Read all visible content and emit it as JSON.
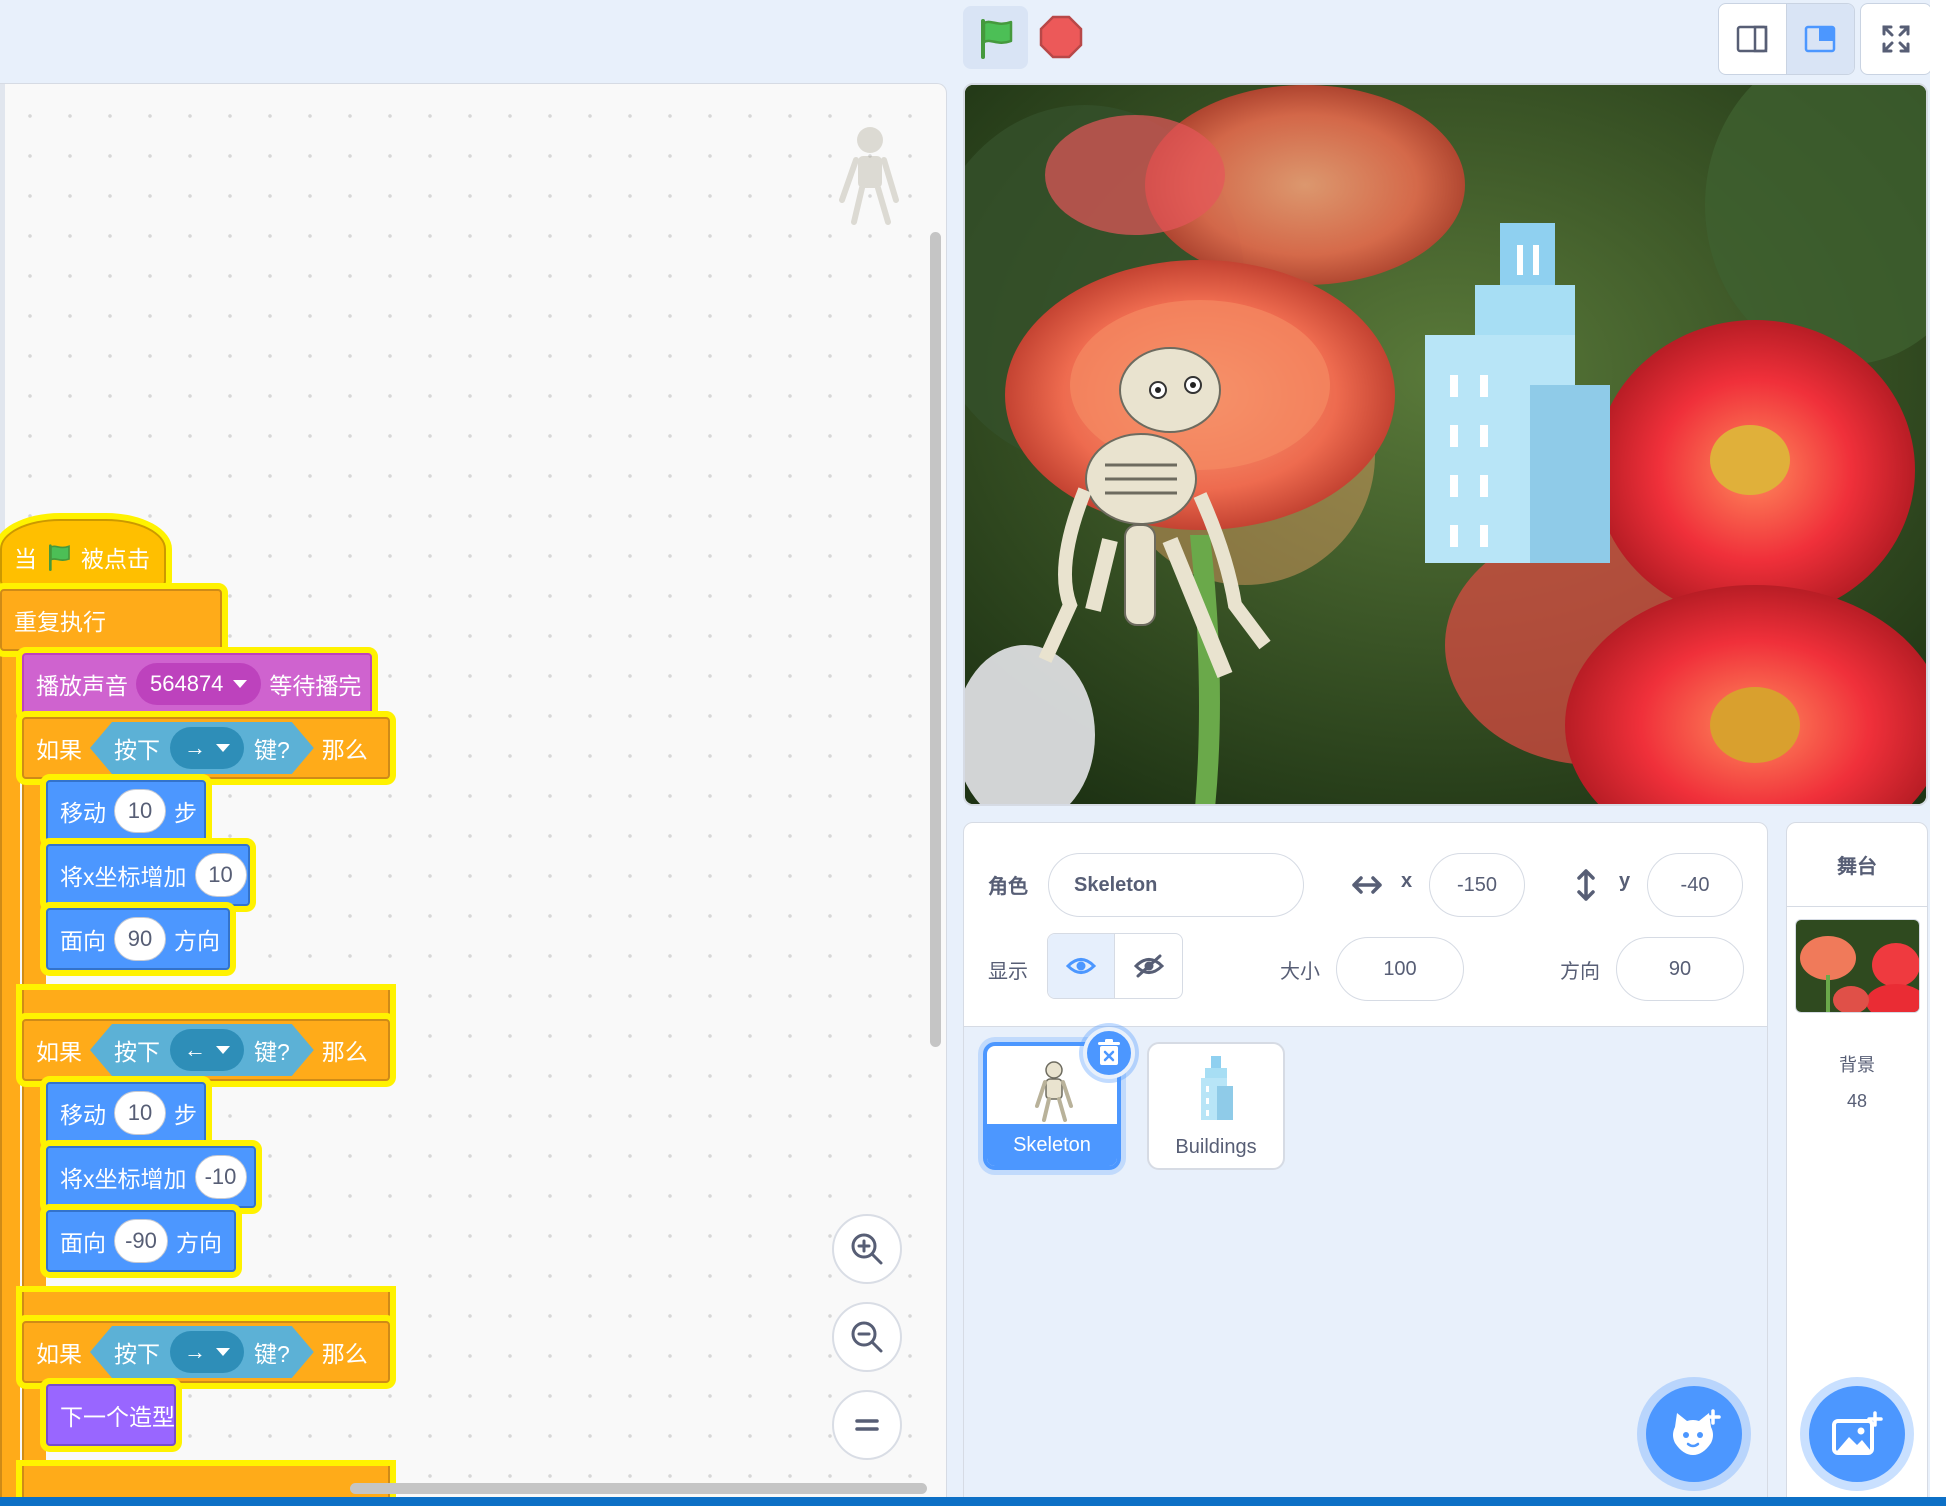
{
  "header": {
    "green_flag_icon": "green-flag-icon",
    "stop_icon": "stop-icon",
    "layout_icons": [
      "small-stage-icon",
      "large-stage-icon",
      "fullscreen-icon"
    ]
  },
  "code": {
    "hat": {
      "when": "当",
      "clicked": "被点击"
    },
    "forever": "重复执行",
    "play_sound": {
      "label": "播放声音",
      "sound": "564874",
      "until": "等待播完"
    },
    "if_blocks": [
      {
        "if": "如果",
        "press": "按下",
        "key": "→",
        "key_q": "键?",
        "then": "那么"
      },
      {
        "if": "如果",
        "press": "按下",
        "key": "←",
        "key_q": "键?",
        "then": "那么"
      },
      {
        "if": "如果",
        "press": "按下",
        "key": "→",
        "key_q": "键?",
        "then": "那么"
      }
    ],
    "branch1": {
      "move": "移动",
      "move_steps": "10",
      "steps": "步",
      "change_x": "将x坐标增加",
      "change_x_value": "10",
      "point": "面向",
      "point_value": "90",
      "direction": "方向"
    },
    "branch2": {
      "move": "移动",
      "move_steps": "10",
      "steps": "步",
      "change_x": "将x坐标增加",
      "change_x_value": "-10",
      "point": "面向",
      "point_value": "-90",
      "direction": "方向"
    },
    "branch3": {
      "next_costume": "下一个造型"
    }
  },
  "sprite_info": {
    "sprite_label": "角色",
    "sprite_name": "Skeleton",
    "x_label": "x",
    "x_value": "-150",
    "y_label": "y",
    "y_value": "-40",
    "show_label": "显示",
    "size_label": "大小",
    "size_value": "100",
    "direction_label": "方向",
    "direction_value": "90"
  },
  "sprites": [
    {
      "name": "Skeleton",
      "selected": true
    },
    {
      "name": "Buildings",
      "selected": false
    }
  ],
  "stage_panel": {
    "title": "舞台",
    "backdrops_label": "背景",
    "backdrops_count": "48"
  },
  "colors": {
    "accent": "#4c97ff",
    "control": "#ffab19",
    "events": "#ffbf00",
    "sound": "#cf63cf",
    "motion": "#4c97ff",
    "looks": "#9966ff",
    "sensing": "#5cb1d6"
  }
}
